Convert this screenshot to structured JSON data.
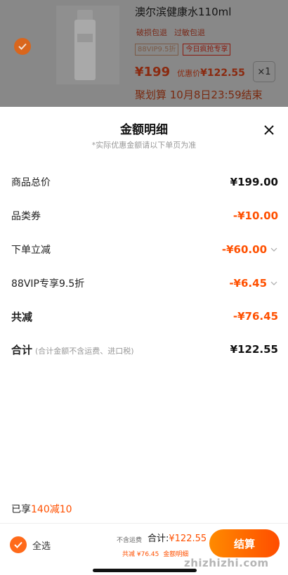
{
  "product": {
    "title": "澳尔滨健康水110ml",
    "tags": [
      "破损包退",
      "过敏包退"
    ],
    "badges": [
      "88VIP9.5折",
      "今日疯抢专享"
    ],
    "price": "¥199",
    "discount_label": "优惠价",
    "discount_price": "¥122.55",
    "qty": "×1",
    "sale_end": "聚划算 10月8日23:59结束"
  },
  "sheet": {
    "title": "金额明细",
    "subtitle": "*实际优惠金额请以下单页为准",
    "rows": [
      {
        "label": "商品总价",
        "value": "¥199.00"
      },
      {
        "label": "品类券",
        "value": "-¥10.00"
      },
      {
        "label": "下单立减",
        "value": "-¥60.00"
      },
      {
        "label": "88VIP专享9.5折",
        "value": "-¥6.45"
      },
      {
        "label": "共减",
        "value": "-¥76.45"
      },
      {
        "label": "合计",
        "note": "(合计金额不含运费、进口税)",
        "value": "¥122.55"
      }
    ],
    "shared_prefix": "已享",
    "shared_value": "140减10"
  },
  "bottom": {
    "select_all": "全选",
    "shipping": "不含运费",
    "total_label": "合计:",
    "total_value": "¥122.55",
    "save_text": "共减 ¥76.45",
    "detail_link": "金额明细",
    "settle": "结算"
  },
  "watermark": "zhizhizhi.com",
  "colors": {
    "accent": "#ff5000",
    "dim_overlay": "#888888"
  }
}
